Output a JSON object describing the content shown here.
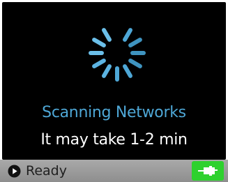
{
  "colors": {
    "accent": "#4ea7d6",
    "screen_bg": "#000000",
    "status_bar": "#9d9d9d",
    "power_indicator": "#2ed12e"
  },
  "main": {
    "spinner_icon": "loading-spinner-icon",
    "title": "Scanning Networks",
    "subtitle": "It may take 1-2 min"
  },
  "status_bar": {
    "icon": "play-circle-icon",
    "text": "Ready",
    "power_icon": "power-plug-icon"
  }
}
